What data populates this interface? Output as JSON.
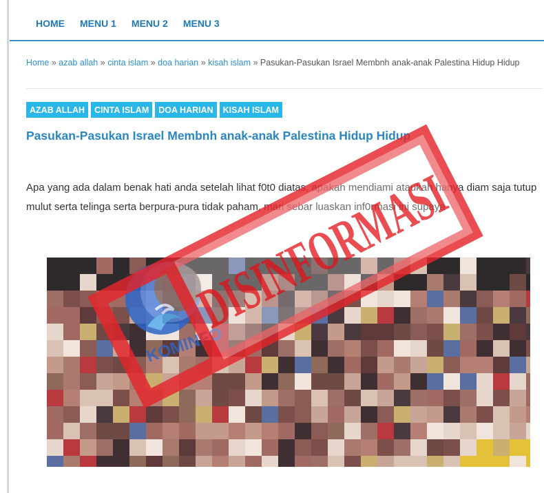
{
  "nav": {
    "items": [
      {
        "label": "HOME"
      },
      {
        "label": "MENU 1"
      },
      {
        "label": "MENU 2"
      },
      {
        "label": "MENU 3"
      }
    ]
  },
  "breadcrumb": {
    "home": "Home",
    "sep": "»",
    "links": [
      "azab allah",
      "cinta islam",
      "doa harian",
      "kisah islam"
    ],
    "current": "Pasukan-Pasukan Israel Membnh anak-anak Palestina Hidup Hidup"
  },
  "tags": [
    "AZAB ALLAH",
    "CINTA ISLAM",
    "DOA HARIAN",
    "KISAH ISLAM"
  ],
  "post": {
    "title": "Pasukan-Pasukan Israel Membnh anak-anak Palestina Hidup Hidup",
    "body": "Apa yang ada dalam benak hati anda setelah lihat f0t0 diatas, apakah mendiami ataukah hanya diam saja tutup mulut serta telinga serta berpura-pura tidak paham, mari sebar luaskan inf0rmasi ini supaya"
  },
  "overlay": {
    "stamp_text": "DISINFORMASI",
    "logo_text": "KOMINFO",
    "stamp_color": "#e5262c",
    "logo_color": "#2d66c8"
  },
  "colors": {
    "nav_text": "#1f79b8",
    "link": "#2e8fcf",
    "tag_bg": "#29b6e8",
    "title": "#2b86c4"
  }
}
